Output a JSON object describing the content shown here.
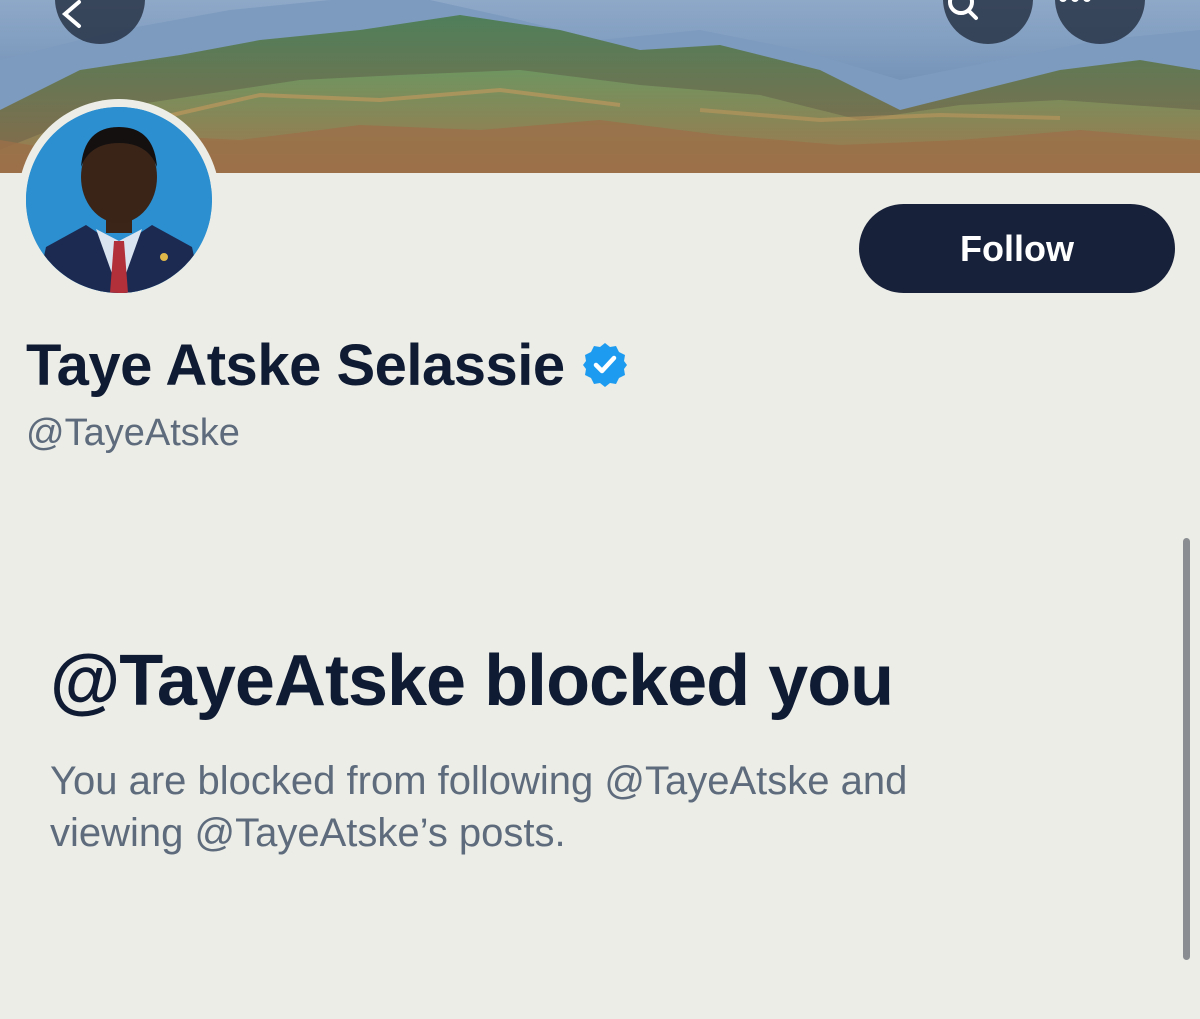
{
  "header": {
    "back_icon": "arrow-left-icon",
    "search_icon": "search-icon",
    "more_icon": "more-horizontal-icon",
    "banner": "mountain landscape banner"
  },
  "profile": {
    "display_name": "Taye Atske Selassie",
    "verified_icon": "verified-badge-icon",
    "verified_color": "#1d9bf0",
    "handle": "@TayeAtske",
    "follow_label": "Follow"
  },
  "blocked": {
    "title": "@TayeAtske blocked you",
    "description": "You are blocked from following @TayeAtske and viewing @TayeAtske’s posts."
  },
  "colors": {
    "background": "#ecede6",
    "primary_button": "#18213a",
    "text_primary": "#0f1a33",
    "text_secondary": "#5d6b7d"
  }
}
